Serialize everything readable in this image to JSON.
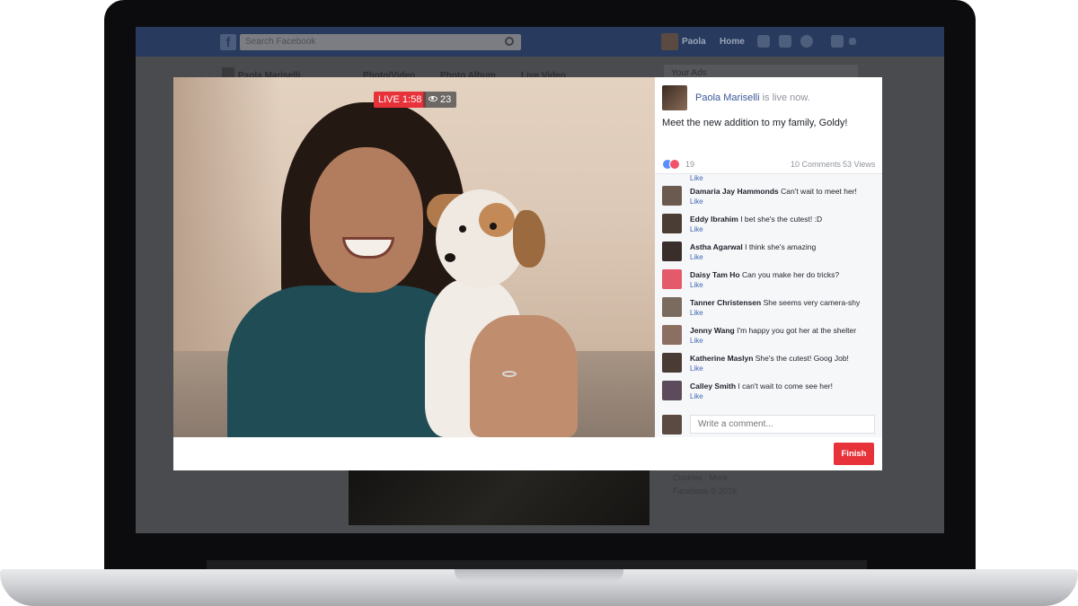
{
  "facebook": {
    "logo": "f",
    "search_placeholder": "Search Facebook",
    "header_name": "Paola",
    "header_home": "Home",
    "profile_name": "Paola Mariselli",
    "composer_tabs": [
      "Photo/Video",
      "Photo Album",
      "Live Video"
    ],
    "ads_label": "Your Ads",
    "footer_links": "Cookies · More",
    "footer_copyright": "Facebook © 2016"
  },
  "live_video": {
    "live_badge": "LIVE 1:58",
    "viewer_count": "23"
  },
  "post": {
    "author": "Paola Mariselli",
    "status": " is live now.",
    "text": "Meet the new addition to my family, Goldy!",
    "reaction_count": "19",
    "comments_count": "10 Comments",
    "views_count": "53 Views"
  },
  "comments": [
    {
      "author": "Damaria Jay Hammonds",
      "text": " Can't wait to meet her!",
      "like": "Like",
      "avatar_color": "#6b5a50"
    },
    {
      "author": "Eddy Ibrahim",
      "text": " I bet she's the cutest! :D",
      "like": "Like",
      "avatar_color": "#4a3d33"
    },
    {
      "author": "Astha Agarwal",
      "text": " I think she's amazing",
      "like": "Like",
      "avatar_color": "#3a2e2a"
    },
    {
      "author": "Daisy Tam Ho",
      "text": " Can you make her do tricks?",
      "like": "Like",
      "avatar_color": "#e35a6a"
    },
    {
      "author": "Tanner Christensen",
      "text": " She seems very camera-shy",
      "like": "Like",
      "avatar_color": "#7b6b5e"
    },
    {
      "author": "Jenny Wang",
      "text": " I'm happy you got her at the shelter",
      "like": "Like",
      "avatar_color": "#8c6f63"
    },
    {
      "author": "Katherine Maslyn",
      "text": " She's the cutest! Goog Job!",
      "like": "Like",
      "avatar_color": "#4a3b35"
    },
    {
      "author": "Calley Smith",
      "text": " I can't wait to come see her!",
      "like": "Like",
      "avatar_color": "#5d4a5a"
    }
  ],
  "clipped_like": "Like",
  "composer": {
    "placeholder": "Write a comment..."
  },
  "actions": {
    "finish_label": "Finish"
  },
  "colors": {
    "live_red": "#e8323a",
    "fb_blue": "#3b5998",
    "link_blue": "#4267b2"
  }
}
